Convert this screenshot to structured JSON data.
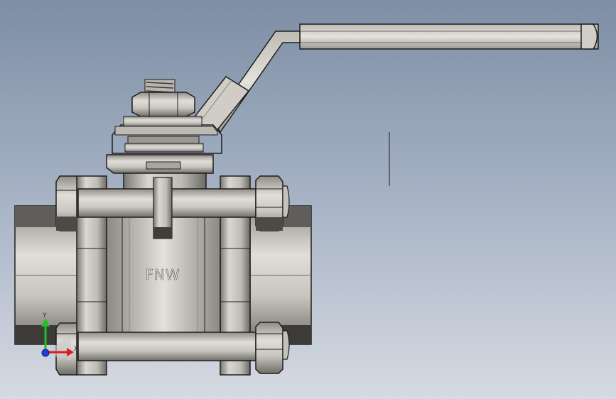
{
  "viewport": {
    "background_top": "#7d8ea5",
    "background_bottom": "#d6dae2"
  },
  "model": {
    "body_marking": "FNW",
    "colors": {
      "metal_light": "#d8d6cf",
      "metal_mid": "#a9a79f",
      "metal_dark": "#5c5b57",
      "outline": "#1e1e1e"
    }
  },
  "triad": {
    "x_label": "X",
    "y_label": "Y",
    "x_color": "#e01b1b",
    "y_color": "#20c020",
    "z_color": "#1f3fd8"
  }
}
